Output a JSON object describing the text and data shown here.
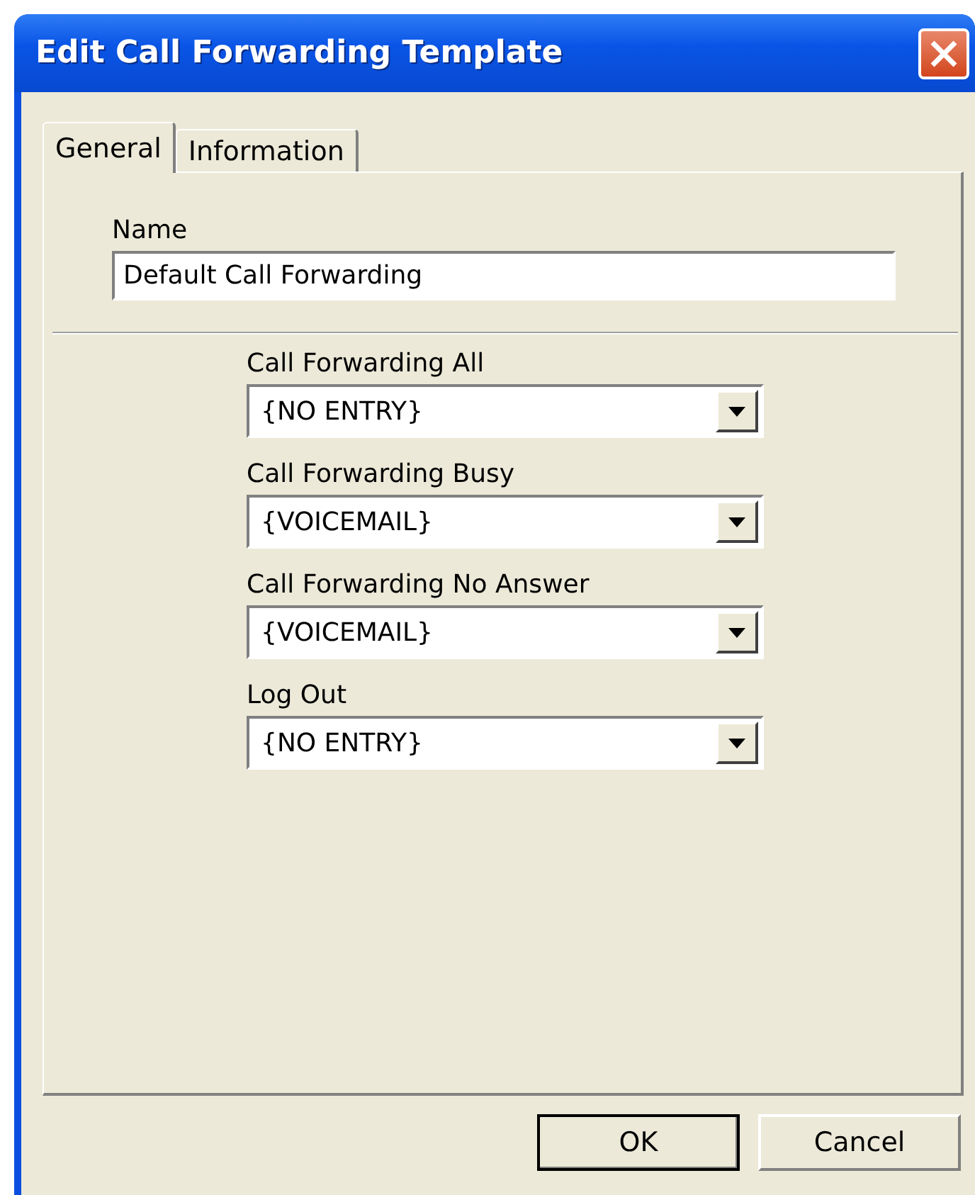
{
  "window": {
    "title": "Edit Call Forwarding Template"
  },
  "tabs": [
    {
      "label": "General",
      "selected": true
    },
    {
      "label": "Information",
      "selected": false
    }
  ],
  "name_field": {
    "label": "Name",
    "value": "Default Call Forwarding"
  },
  "dropdowns": [
    {
      "label": "Call Forwarding All",
      "value": "{NO ENTRY}"
    },
    {
      "label": "Call Forwarding Busy",
      "value": "{VOICEMAIL}"
    },
    {
      "label": "Call Forwarding No Answer",
      "value": "{VOICEMAIL}"
    },
    {
      "label": "Log Out",
      "value": "{NO ENTRY}"
    }
  ],
  "buttons": [
    {
      "label": "OK",
      "default": true
    },
    {
      "label": "Cancel",
      "default": false
    }
  ]
}
